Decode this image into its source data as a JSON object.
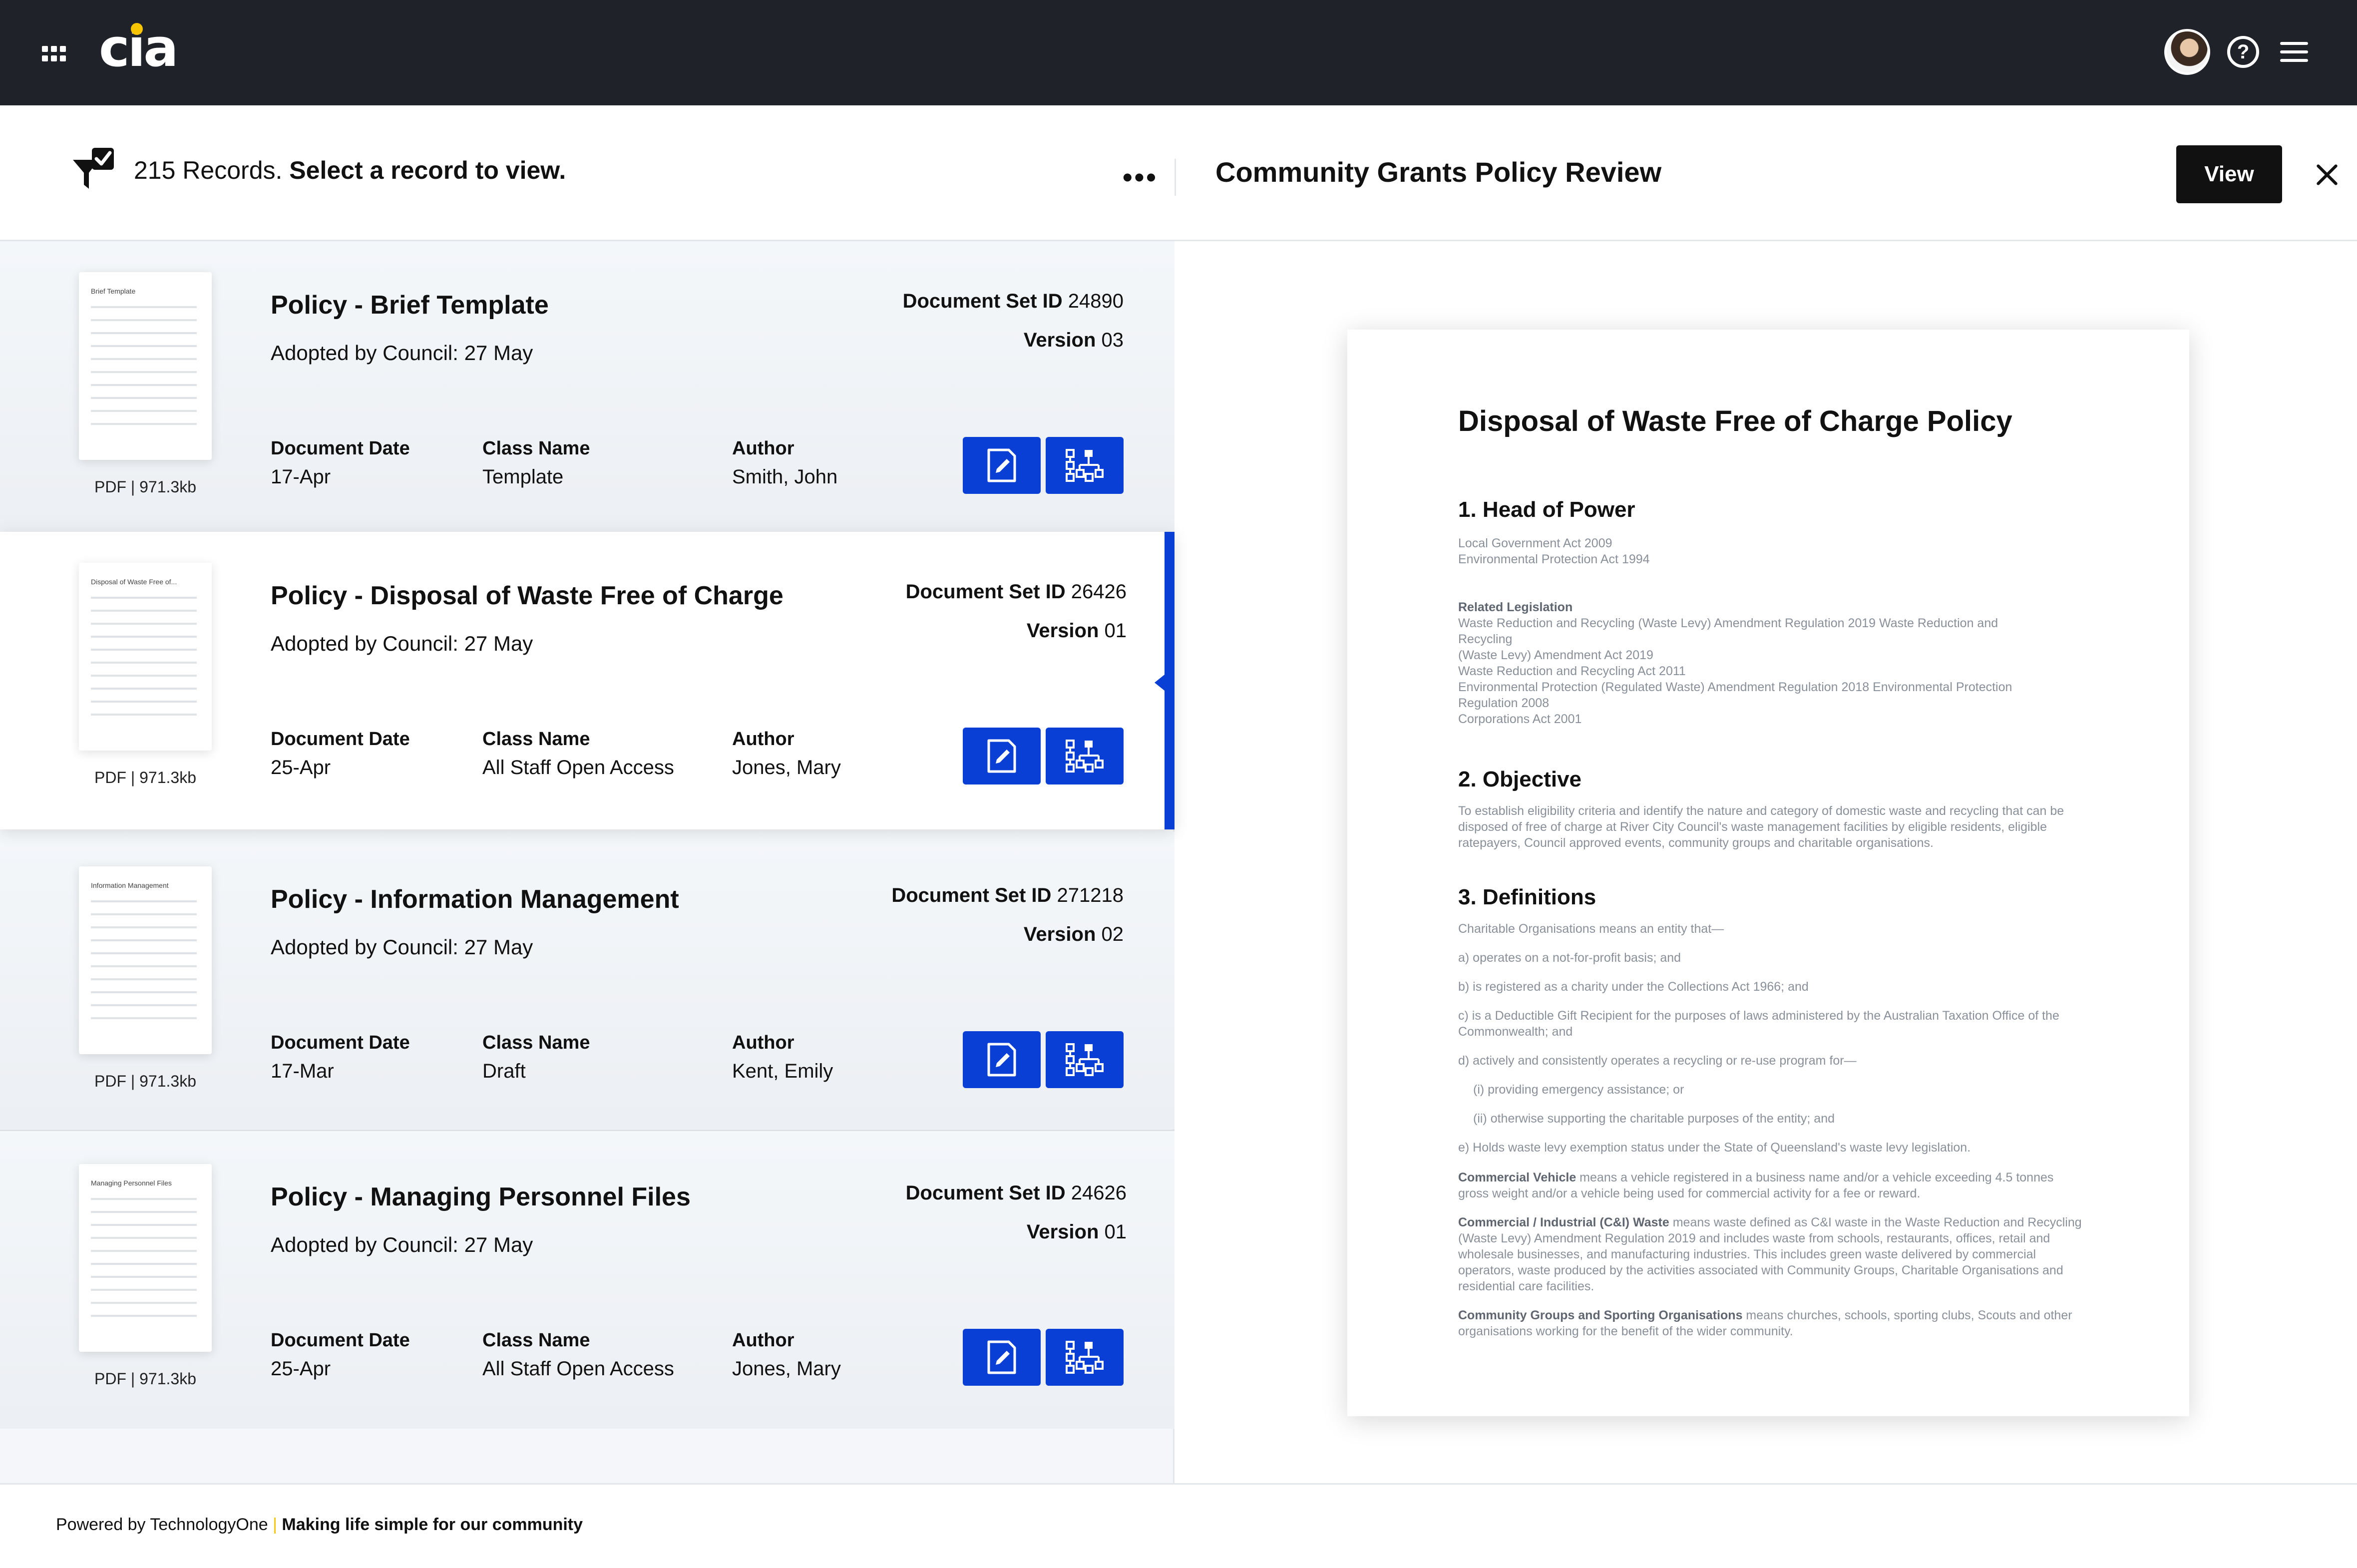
{
  "header": {
    "logo_text": "cia",
    "accent_color": "#f6c400",
    "icons": [
      "apps-grid-icon",
      "user-avatar",
      "help-icon",
      "hamburger-menu-icon"
    ]
  },
  "toolbar": {
    "records_count": "215 Records.",
    "records_prompt": "Select a record to view.",
    "more_label": "•••",
    "preview_title": "Community Grants Policy Review",
    "view_label": "View"
  },
  "records": [
    {
      "title": "Policy - Brief Template",
      "adopted": "Adopted by Council: 27 May",
      "doc_set_id_label": "Document Set ID",
      "doc_set_id": "24890",
      "version_label": "Version",
      "version": "03",
      "date_label": "Document Date",
      "date": "17-Apr",
      "class_label": "Class Name",
      "class": "Template",
      "author_label": "Author",
      "author": "Smith, John",
      "file_info": "PDF | 971.3kb",
      "thumb_title": "Brief Template"
    },
    {
      "title": "Policy - Disposal of Waste Free of Charge",
      "adopted": "Adopted by Council: 27 May",
      "doc_set_id_label": "Document Set ID",
      "doc_set_id": "26426",
      "version_label": "Version",
      "version": "01",
      "date_label": "Document Date",
      "date": "25-Apr",
      "class_label": "Class Name",
      "class": "All Staff Open Access",
      "author_label": "Author",
      "author": "Jones, Mary",
      "file_info": "PDF | 971.3kb",
      "thumb_title": "Disposal of Waste Free of..."
    },
    {
      "title": "Policy - Information Management",
      "adopted": "Adopted by Council: 27 May",
      "doc_set_id_label": "Document Set ID",
      "doc_set_id": "271218",
      "version_label": "Version",
      "version": "02",
      "date_label": "Document Date",
      "date": "17-Mar",
      "class_label": "Class Name",
      "class": "Draft",
      "author_label": "Author",
      "author": "Kent, Emily",
      "file_info": "PDF | 971.3kb",
      "thumb_title": "Information Management"
    },
    {
      "title": "Policy - Managing Personnel Files",
      "adopted": "Adopted by Council: 27 May",
      "doc_set_id_label": "Document Set ID",
      "doc_set_id": "24626",
      "version_label": "Version",
      "version": "01",
      "date_label": "Document Date",
      "date": "25-Apr",
      "class_label": "Class Name",
      "class": "All Staff Open Access",
      "author_label": "Author",
      "author": "Jones, Mary",
      "file_info": "PDF | 971.3kb",
      "thumb_title": "Managing Personnel Files"
    }
  ],
  "selected_record": 2,
  "preview_doc": {
    "title": "Disposal of Waste Free of Charge Policy",
    "s1_heading": "1. Head of Power",
    "s1_lines": [
      "Local Government Act 2009",
      "Environmental Protection Act 1994"
    ],
    "related_heading": "Related Legislation",
    "related_lines": [
      "Waste Reduction and Recycling (Waste Levy) Amendment Regulation 2019 Waste Reduction and",
      "Recycling",
      "(Waste Levy) Amendment Act 2019",
      "Waste Reduction and Recycling Act 2011",
      "Environmental Protection (Regulated Waste) Amendment Regulation 2018 Environmental Protection",
      "Regulation 2008",
      "Corporations Act 2001"
    ],
    "s2_heading": "2. Objective",
    "s2_text": "To establish eligibility criteria and identify the nature and category of domestic waste and recycling that can be disposed of free of charge at River City Council's waste management facilities by eligible residents, eligible ratepayers, Council approved events, community groups and charitable organisations.",
    "s3_heading": "3. Definitions",
    "def_intro": "Charitable Organisations means an entity that—",
    "def_a": "a) operates on a not-for-profit basis; and",
    "def_b": "b) is registered as a charity under the Collections Act 1966; and",
    "def_c": "c) is a Deductible Gift Recipient for the purposes of laws administered by the Australian Taxation Office of the Commonwealth; and",
    "def_d": "d) actively and consistently operates a recycling or re-use program for—",
    "def_d1": "(i) providing emergency assistance; or",
    "def_d2": "(ii) otherwise supporting the charitable purposes of the entity; and",
    "def_e": "e) Holds waste levy exemption status under the State of Queensland's waste levy legislation.",
    "cv_term": "Commercial Vehicle",
    "cv_text": " means a vehicle registered in a business name and/or a vehicle exceeding 4.5 tonnes gross weight and/or a vehicle being used for commercial activity for a fee or reward.",
    "ci_term": "Commercial / Industrial (C&I) Waste",
    "ci_text": " means waste defined as C&I waste in the Waste Reduction and Recycling (Waste Levy) Amendment Regulation 2019 and includes waste from schools, restaurants, offices, retail and wholesale businesses, and manufacturing industries. This includes green waste delivered by commercial operators, waste produced by the activities associated with Community Groups, Charitable Organisations and residential care facilities.",
    "cg_term": "Community Groups and Sporting Organisations",
    "cg_text": " means churches, schools, sporting clubs, Scouts and other organisations working for the benefit of the wider community."
  },
  "footer": {
    "powered": "Powered by TechnologyOne",
    "divider": "|",
    "tagline": "Making life simple for our community"
  },
  "colors": {
    "topbar": "#1f2228",
    "primary": "#0a3fd6",
    "text": "#111111",
    "muted": "#8a9099"
  }
}
